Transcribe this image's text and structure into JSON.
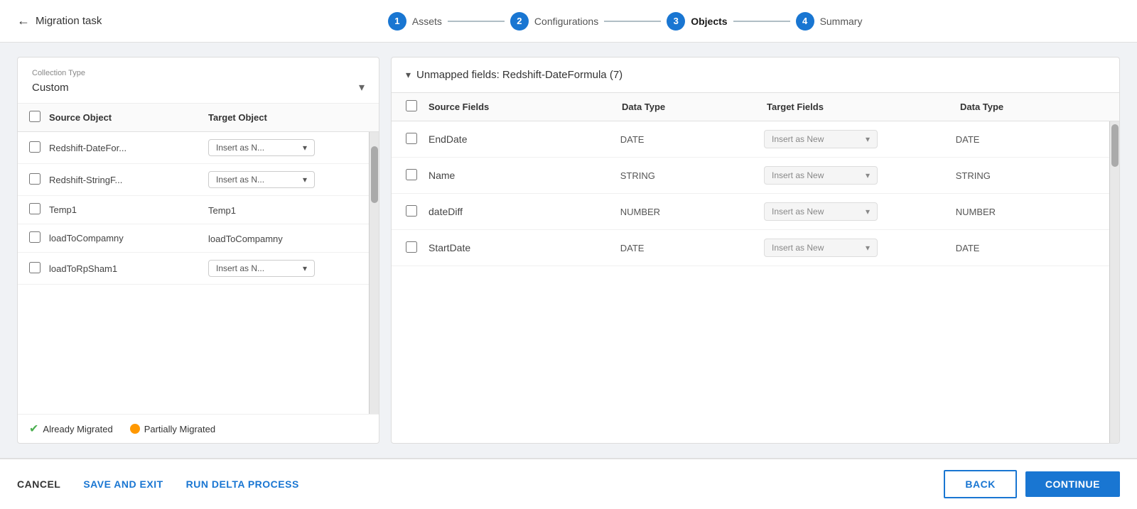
{
  "header": {
    "back_label": "Migration task",
    "back_arrow": "←"
  },
  "stepper": {
    "steps": [
      {
        "id": 1,
        "label": "Assets",
        "active": false
      },
      {
        "id": 2,
        "label": "Configurations",
        "active": false
      },
      {
        "id": 3,
        "label": "Objects",
        "active": true
      },
      {
        "id": 4,
        "label": "Summary",
        "active": false
      }
    ]
  },
  "left_panel": {
    "collection_type_label": "Collection Type",
    "collection_type_value": "Custom",
    "col_source": "Source Object",
    "col_target": "Target Object",
    "rows": [
      {
        "source": "Redshift-DateFor...",
        "target_text": "Insert as N...",
        "has_dropdown": true
      },
      {
        "source": "Redshift-StringF...",
        "target_text": "Insert as N...",
        "has_dropdown": true
      },
      {
        "source": "Temp1",
        "target_text": "Temp1",
        "has_dropdown": false
      },
      {
        "source": "loadToCompamny",
        "target_text": "loadToCompamny",
        "has_dropdown": false
      },
      {
        "source": "loadToRpSham1",
        "target_text": "Insert as N...",
        "has_dropdown": true
      }
    ]
  },
  "legend": {
    "already_migrated": "Already Migrated",
    "partially_migrated": "Partially Migrated"
  },
  "right_panel": {
    "unmapped_title": "Unmapped fields: Redshift-DateFormula (7)",
    "col_source": "Source Fields",
    "col_dtype": "Data Type",
    "col_target": "Target Fields",
    "col_dtype2": "Data Type",
    "rows": [
      {
        "source": "EndDate",
        "dtype": "DATE",
        "target_placeholder": "Insert as New",
        "dtype2": "DATE"
      },
      {
        "source": "Name",
        "dtype": "STRING",
        "target_placeholder": "Insert as New",
        "dtype2": "STRING"
      },
      {
        "source": "dateDiff",
        "dtype": "NUMBER",
        "target_placeholder": "Insert as New",
        "dtype2": "NUMBER"
      },
      {
        "source": "StartDate",
        "dtype": "DATE",
        "target_placeholder": "Insert as New",
        "dtype2": "DATE"
      }
    ]
  },
  "footer": {
    "cancel_label": "CANCEL",
    "save_label": "SAVE AND EXIT",
    "delta_label": "RUN DELTA PROCESS",
    "back_label": "BACK",
    "continue_label": "CONTINUE"
  }
}
